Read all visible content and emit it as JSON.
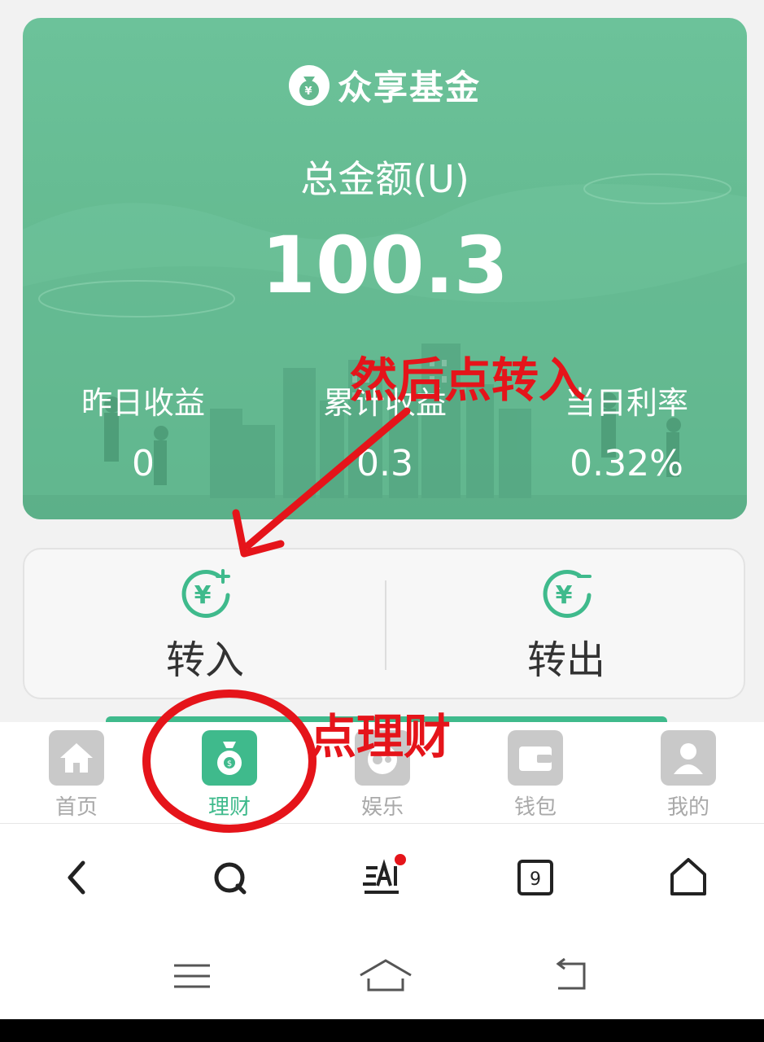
{
  "fund_card": {
    "title": "众享基金",
    "total_label": "总金额(U)",
    "total_amount": "100.3",
    "stats": [
      {
        "label": "昨日收益",
        "value": "0"
      },
      {
        "label": "累计收益",
        "value": "0.3"
      },
      {
        "label": "当日利率",
        "value": "0.32%"
      }
    ],
    "colors": {
      "card_green": "#63b98f"
    }
  },
  "actions": {
    "transfer_in": "转入",
    "transfer_out": "转出",
    "icon_color": "#3fba8c"
  },
  "bottom_tabs": [
    {
      "label": "首页",
      "icon": "home-icon",
      "active": false
    },
    {
      "label": "理财",
      "icon": "money-bag-icon",
      "active": true
    },
    {
      "label": "娱乐",
      "icon": "game-icon",
      "active": false
    },
    {
      "label": "钱包",
      "icon": "wallet-icon",
      "active": false
    },
    {
      "label": "我的",
      "icon": "user-icon",
      "active": false
    }
  ],
  "browser_toolbar": {
    "tab_count": "9",
    "items": [
      "back-icon",
      "search-icon",
      "ai-icon",
      "tabs-icon",
      "home-icon"
    ]
  },
  "system_nav": [
    "menu-icon",
    "home-icon",
    "back-icon"
  ],
  "annotations": {
    "arrow_note": "然后点转入",
    "circle_note": "点理财",
    "color": "#e5141a"
  }
}
